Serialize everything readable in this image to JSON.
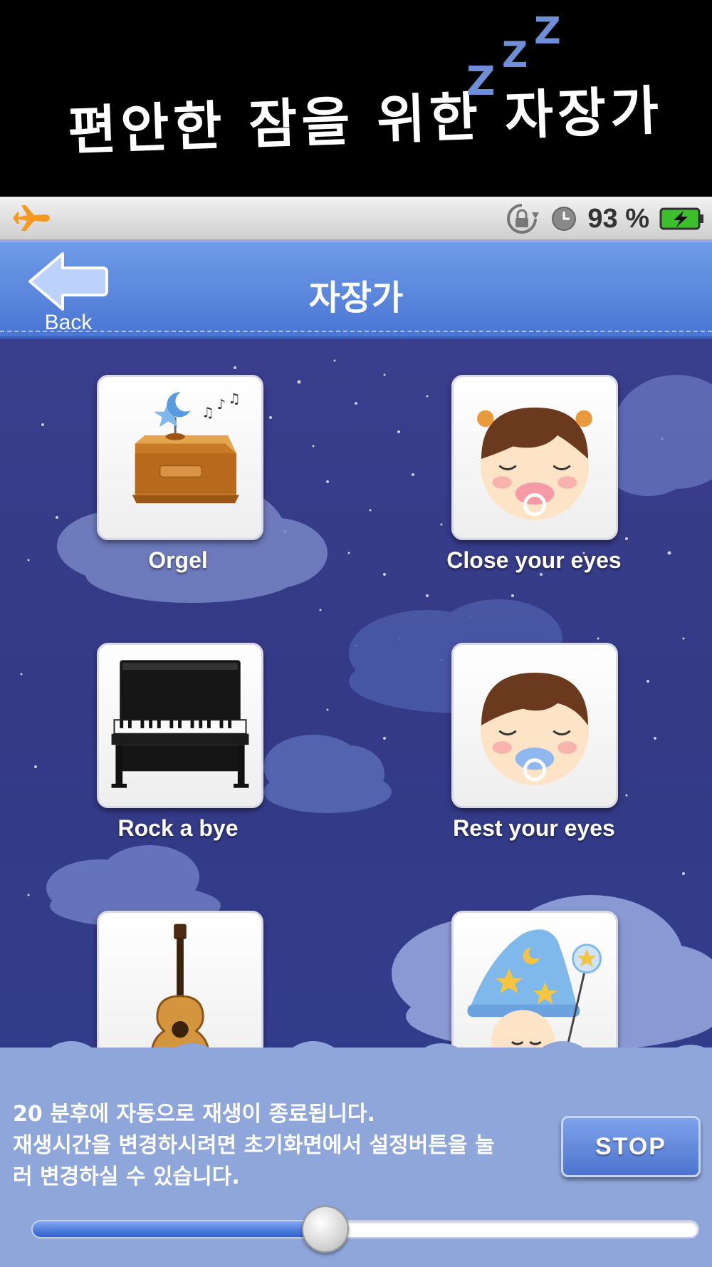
{
  "promo": {
    "title": "편안한 잠을 위한 자장가",
    "z1": "Z",
    "z2": "Z",
    "z3": "Z"
  },
  "statusbar": {
    "left_icon": "airplane-icon",
    "icons": [
      "rotation-lock-icon",
      "alarm-clock-icon"
    ],
    "battery_percent": "93 %",
    "battery_icon": "battery-charging-icon"
  },
  "navbar": {
    "back_label": "Back",
    "title": "자장가"
  },
  "tiles": [
    {
      "label": "Orgel",
      "icon": "music-box-icon"
    },
    {
      "label": "Close your eyes",
      "icon": "sleeping-girl-icon"
    },
    {
      "label": "Rock a bye",
      "icon": "piano-icon"
    },
    {
      "label": "Rest your eyes",
      "icon": "sleeping-boy-icon"
    },
    {
      "label": "",
      "icon": "guitar-icon"
    },
    {
      "label": "",
      "icon": "wizard-baby-icon"
    }
  ],
  "bottom": {
    "line1": "20 분후에 자동으로 재생이 종료됩니다.",
    "line2": "재생시간을 변경하시려면 초기화면에서 설정버튼을 눌",
    "line3": "러 변경하실 수 있습니다.",
    "stop_label": "STOP",
    "timer_progress_fraction": 0.44
  },
  "colors": {
    "nav_blue": "#5a86dc",
    "night_sky": "#363b8a",
    "panel_blue": "#8ea6d9",
    "accent_orange": "#f59a1e",
    "battery_green": "#3bbf2a"
  }
}
